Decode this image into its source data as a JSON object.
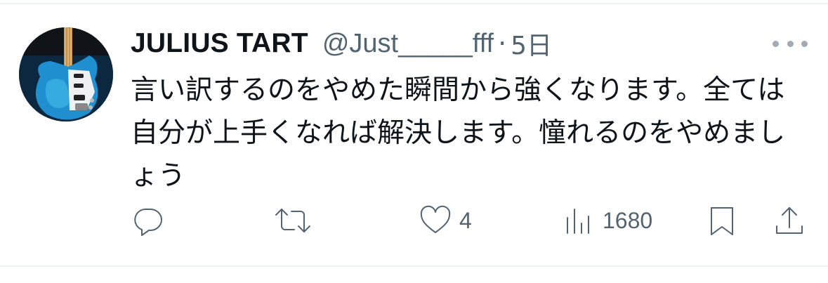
{
  "tweet": {
    "author_name": "JULIUS TART",
    "author_handle": "@Just_____fff",
    "separator": "·",
    "timestamp": "5日",
    "text": "言い訳するのをやめた瞬間から強くなります。全ては自分が上手くなれば解決します。憧れるのをやめましょう"
  },
  "avatar": {
    "icon": "guitar-avatar",
    "colors": {
      "body": "#1f8fd0",
      "background": "#0c2740"
    }
  },
  "actions": {
    "reply": {
      "icon": "reply-icon",
      "count": ""
    },
    "retweet": {
      "icon": "retweet-icon",
      "count": ""
    },
    "like": {
      "icon": "heart-icon",
      "count": "4"
    },
    "views": {
      "icon": "views-icon",
      "count": "1680"
    },
    "bookmark": {
      "icon": "bookmark-icon"
    },
    "share": {
      "icon": "share-icon"
    }
  },
  "colors": {
    "text": "#0f1419",
    "secondary": "#536471",
    "divider": "#eff3f4"
  }
}
